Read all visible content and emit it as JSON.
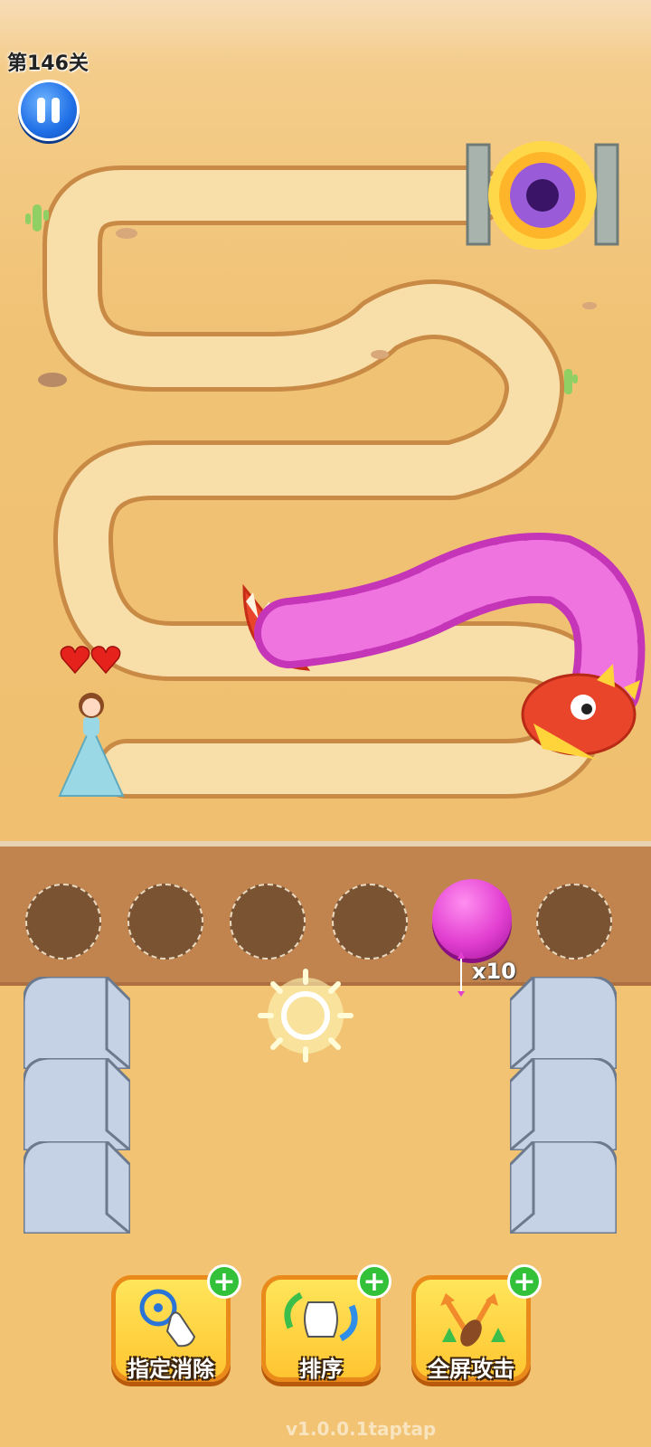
{
  "hud": {
    "level": "第146关"
  },
  "icons": {
    "pause": "pause-icon",
    "portal": "black-hole-portal-icon",
    "hearts": "heart-icon",
    "arrow": "arrow-icon",
    "sun": "sun-icon"
  },
  "player": {
    "lives": 2
  },
  "slots": {
    "count": 6,
    "filled": [
      false,
      false,
      false,
      false,
      true,
      false
    ],
    "ammo": "x10",
    "ball_color": "#e23fd0"
  },
  "tools": [
    {
      "label": "指定消除",
      "icon": "target-tap-icon",
      "add": "+"
    },
    {
      "label": "排序",
      "icon": "shuffle-hand-icon",
      "add": "+"
    },
    {
      "label": "全屏攻击",
      "icon": "fullscreen-attack-icon",
      "add": "+"
    }
  ],
  "footer": {
    "version": "v1.0.0.1taptap"
  },
  "colors": {
    "track": "#f7dca6",
    "sand": "#f0c274",
    "dragon_scales": "#e85fd6",
    "dragon_head": "#e8452a"
  }
}
